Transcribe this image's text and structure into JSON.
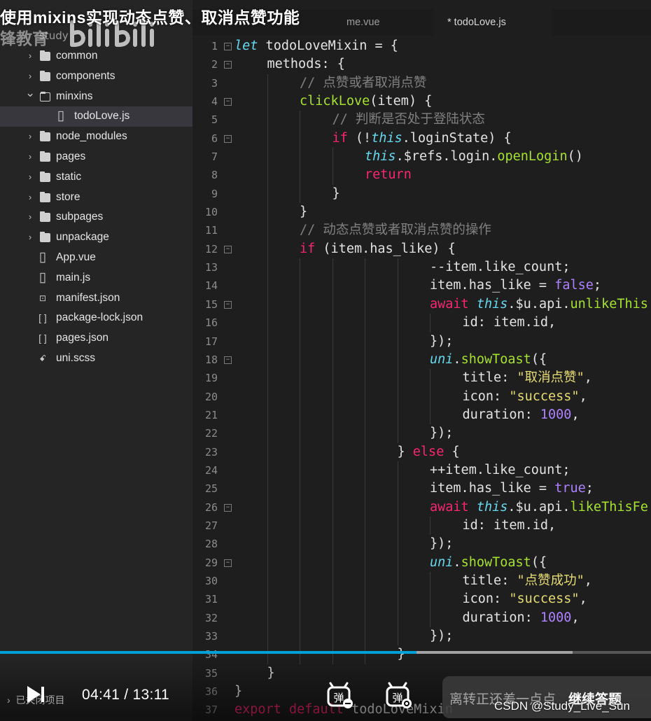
{
  "video": {
    "title": "使用mixins实现动态点赞、取消点赞功能",
    "watermark_text": "锋教育",
    "current_time": "04:41",
    "separator": "/",
    "duration": "13:11",
    "progress_fraction": 0.64,
    "buffer_fraction": 0.88,
    "closed_projects_label": "已关闭项目",
    "danmu_label": "弹",
    "quiz_text": "离转正还差一点点",
    "quiz_action": "继续答题",
    "source_watermark": "CSDN @Study_Live_Sun",
    "accent_color": "#00a1d6"
  },
  "sidebar": {
    "project": "study",
    "items": [
      {
        "label": "common",
        "type": "folder",
        "expanded": false,
        "depth": 0
      },
      {
        "label": "components",
        "type": "folder",
        "expanded": false,
        "depth": 0
      },
      {
        "label": "minxins",
        "type": "folder",
        "expanded": true,
        "depth": 0
      },
      {
        "label": "todoLove.js",
        "type": "file",
        "icon": "js-file-icon",
        "depth": 1,
        "selected": true
      },
      {
        "label": "node_modules",
        "type": "folder",
        "expanded": false,
        "depth": 0
      },
      {
        "label": "pages",
        "type": "folder",
        "expanded": false,
        "depth": 0
      },
      {
        "label": "static",
        "type": "folder",
        "expanded": false,
        "depth": 0
      },
      {
        "label": "store",
        "type": "folder",
        "expanded": false,
        "depth": 0
      },
      {
        "label": "subpages",
        "type": "folder",
        "expanded": false,
        "depth": 0
      },
      {
        "label": "unpackage",
        "type": "folder",
        "expanded": false,
        "depth": 0
      },
      {
        "label": "App.vue",
        "type": "file",
        "icon": "vue-file-icon",
        "depth": 0
      },
      {
        "label": "main.js",
        "type": "file",
        "icon": "js-file-icon",
        "depth": 0
      },
      {
        "label": "manifest.json",
        "type": "file",
        "icon": "manifest-file-icon",
        "depth": 0
      },
      {
        "label": "package-lock.json",
        "type": "file",
        "icon": "json-file-icon",
        "depth": 0
      },
      {
        "label": "pages.json",
        "type": "file",
        "icon": "json-file-icon",
        "depth": 0
      },
      {
        "label": "uni.scss",
        "type": "file",
        "icon": "scss-file-icon",
        "depth": 0
      }
    ]
  },
  "tabs": [
    {
      "label": "me.vue",
      "active": false
    },
    {
      "label": "* todoLove.js",
      "active": true
    }
  ],
  "editor": {
    "colors": {
      "keyword": "#f92672",
      "builtin": "#66d9ef",
      "function": "#a6e22e",
      "comment": "#808080",
      "number": "#ae81ff",
      "string": "#e6db74"
    },
    "lines": [
      {
        "n": "1",
        "fold": true,
        "indent": 0,
        "tokens": [
          [
            "let",
            "t-let"
          ],
          [
            " todoLoveMixin = {",
            "t-plain"
          ]
        ]
      },
      {
        "n": "2",
        "fold": true,
        "indent": 1,
        "tokens": [
          [
            "methods: {",
            "t-plain"
          ]
        ]
      },
      {
        "n": "3",
        "fold": false,
        "indent": 2,
        "tokens": [
          [
            "// 点赞或者取消点赞",
            "t-cmt"
          ]
        ]
      },
      {
        "n": "4",
        "fold": true,
        "indent": 2,
        "tokens": [
          [
            "clickLove",
            "t-fn"
          ],
          [
            "(item) {",
            "t-plain"
          ]
        ]
      },
      {
        "n": "5",
        "fold": false,
        "indent": 3,
        "tokens": [
          [
            "// 判断是否处于登陆状态",
            "t-cmt"
          ]
        ]
      },
      {
        "n": "6",
        "fold": true,
        "indent": 3,
        "tokens": [
          [
            "if",
            "t-kw"
          ],
          [
            " (!",
            "t-plain"
          ],
          [
            "this",
            "t-this"
          ],
          [
            ".loginState) {",
            "t-plain"
          ]
        ]
      },
      {
        "n": "7",
        "fold": false,
        "indent": 4,
        "tokens": [
          [
            "this",
            "t-this"
          ],
          [
            ".$refs.login.",
            "t-plain"
          ],
          [
            "openLogin",
            "t-fn"
          ],
          [
            "()",
            "t-plain"
          ]
        ]
      },
      {
        "n": "8",
        "fold": false,
        "indent": 4,
        "tokens": [
          [
            "return",
            "t-kw"
          ]
        ]
      },
      {
        "n": "9",
        "fold": false,
        "indent": 3,
        "tokens": [
          [
            "}",
            "t-plain"
          ]
        ]
      },
      {
        "n": "10",
        "fold": false,
        "indent": 2,
        "tokens": [
          [
            "}",
            "t-plain"
          ]
        ]
      },
      {
        "n": "11",
        "fold": false,
        "indent": 2,
        "tokens": [
          [
            "// 动态点赞或者取消点赞的操作",
            "t-cmt"
          ]
        ]
      },
      {
        "n": "12",
        "fold": true,
        "indent": 2,
        "tokens": [
          [
            "if",
            "t-kw"
          ],
          [
            " (item.has_like) {",
            "t-plain"
          ]
        ]
      },
      {
        "n": "13",
        "fold": false,
        "indent": 6,
        "tokens": [
          [
            "--item.like_count;",
            "t-plain"
          ]
        ]
      },
      {
        "n": "14",
        "fold": false,
        "indent": 6,
        "tokens": [
          [
            "item.has_like = ",
            "t-plain"
          ],
          [
            "false",
            "t-bool"
          ],
          [
            ";",
            "t-plain"
          ]
        ]
      },
      {
        "n": "15",
        "fold": true,
        "indent": 6,
        "tokens": [
          [
            "await",
            "t-kw"
          ],
          [
            " ",
            "t-plain"
          ],
          [
            "this",
            "t-this"
          ],
          [
            ".$u.api.",
            "t-plain"
          ],
          [
            "unlikeThis",
            "t-fn"
          ]
        ]
      },
      {
        "n": "16",
        "fold": false,
        "indent": 7,
        "tokens": [
          [
            "id: item.id,",
            "t-plain"
          ]
        ]
      },
      {
        "n": "17",
        "fold": false,
        "indent": 6,
        "tokens": [
          [
            "});",
            "t-plain"
          ]
        ]
      },
      {
        "n": "18",
        "fold": true,
        "indent": 6,
        "tokens": [
          [
            "uni",
            "t-this"
          ],
          [
            ".",
            "t-plain"
          ],
          [
            "showToast",
            "t-fn"
          ],
          [
            "({",
            "t-plain"
          ]
        ]
      },
      {
        "n": "19",
        "fold": false,
        "indent": 7,
        "tokens": [
          [
            "title: ",
            "t-plain"
          ],
          [
            "\"取消点赞\"",
            "t-str"
          ],
          [
            ",",
            "t-plain"
          ]
        ]
      },
      {
        "n": "20",
        "fold": false,
        "indent": 7,
        "tokens": [
          [
            "icon: ",
            "t-plain"
          ],
          [
            "\"success\"",
            "t-str"
          ],
          [
            ",",
            "t-plain"
          ]
        ]
      },
      {
        "n": "21",
        "fold": false,
        "indent": 7,
        "tokens": [
          [
            "duration: ",
            "t-plain"
          ],
          [
            "1000",
            "t-num"
          ],
          [
            ",",
            "t-plain"
          ]
        ]
      },
      {
        "n": "22",
        "fold": false,
        "indent": 6,
        "tokens": [
          [
            "});",
            "t-plain"
          ]
        ]
      },
      {
        "n": "23",
        "fold": false,
        "indent": 5,
        "tokens": [
          [
            "} ",
            "t-plain"
          ],
          [
            "else",
            "t-kw"
          ],
          [
            " {",
            "t-plain"
          ]
        ]
      },
      {
        "n": "24",
        "fold": false,
        "indent": 6,
        "tokens": [
          [
            "++item.like_count;",
            "t-plain"
          ]
        ]
      },
      {
        "n": "25",
        "fold": false,
        "indent": 6,
        "tokens": [
          [
            "item.has_like = ",
            "t-plain"
          ],
          [
            "true",
            "t-bool"
          ],
          [
            ";",
            "t-plain"
          ]
        ]
      },
      {
        "n": "26",
        "fold": true,
        "indent": 6,
        "tokens": [
          [
            "await",
            "t-kw"
          ],
          [
            " ",
            "t-plain"
          ],
          [
            "this",
            "t-this"
          ],
          [
            ".$u.api.",
            "t-plain"
          ],
          [
            "likeThisFe",
            "t-fn"
          ]
        ]
      },
      {
        "n": "27",
        "fold": false,
        "indent": 7,
        "tokens": [
          [
            "id: item.id,",
            "t-plain"
          ]
        ]
      },
      {
        "n": "28",
        "fold": false,
        "indent": 6,
        "tokens": [
          [
            "});",
            "t-plain"
          ]
        ]
      },
      {
        "n": "29",
        "fold": true,
        "indent": 6,
        "tokens": [
          [
            "uni",
            "t-this"
          ],
          [
            ".",
            "t-plain"
          ],
          [
            "showToast",
            "t-fn"
          ],
          [
            "({",
            "t-plain"
          ]
        ]
      },
      {
        "n": "30",
        "fold": false,
        "indent": 7,
        "tokens": [
          [
            "title: ",
            "t-plain"
          ],
          [
            "\"点赞成功\"",
            "t-str"
          ],
          [
            ",",
            "t-plain"
          ]
        ]
      },
      {
        "n": "31",
        "fold": false,
        "indent": 7,
        "tokens": [
          [
            "icon: ",
            "t-plain"
          ],
          [
            "\"success\"",
            "t-str"
          ],
          [
            ",",
            "t-plain"
          ]
        ]
      },
      {
        "n": "32",
        "fold": false,
        "indent": 7,
        "tokens": [
          [
            "duration: ",
            "t-plain"
          ],
          [
            "1000",
            "t-num"
          ],
          [
            ",",
            "t-plain"
          ]
        ]
      },
      {
        "n": "33",
        "fold": false,
        "indent": 6,
        "tokens": [
          [
            "});",
            "t-plain"
          ]
        ]
      },
      {
        "n": "34",
        "fold": false,
        "indent": 5,
        "tokens": [
          [
            "}",
            "t-plain"
          ]
        ]
      },
      {
        "n": "35",
        "fold": false,
        "indent": 1,
        "tokens": [
          [
            "}",
            "t-plain"
          ]
        ]
      },
      {
        "n": "36",
        "fold": false,
        "indent": 0,
        "tokens": [
          [
            "}",
            "t-plain"
          ]
        ]
      },
      {
        "n": "37",
        "fold": false,
        "indent": 0,
        "tokens": [
          [
            "export",
            "t-kw"
          ],
          [
            " ",
            "t-plain"
          ],
          [
            "default",
            "t-kw"
          ],
          [
            " todoLoveMixin",
            "t-plain"
          ]
        ]
      }
    ]
  }
}
